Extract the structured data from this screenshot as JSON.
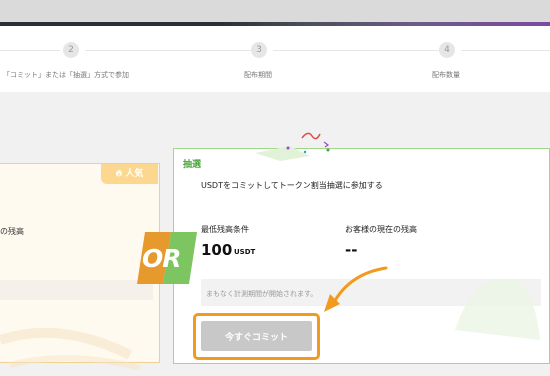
{
  "steps": [
    {
      "num": "",
      "label": "「コミット」または「抽選」方式で参加"
    },
    {
      "num": "2",
      "label": ""
    },
    {
      "num": "3",
      "label": "配布期間"
    },
    {
      "num": "4",
      "label": "配布数量"
    }
  ],
  "left_card": {
    "badge": "人気",
    "text": "の残高"
  },
  "or_label": "OR",
  "lottery_card": {
    "tab_title": "抽選",
    "description": "USDTをコミットしてトークン割当抽選に参加する",
    "min_balance_label": "最低残高条件",
    "min_balance_value": "100",
    "min_balance_unit": "USDT",
    "current_balance_label": "お客様の現在の残高",
    "current_balance_value": "--",
    "notice": "まもなく計測期間が開始されます。",
    "commit_button": "今すぐコミット"
  },
  "colors": {
    "highlight": "#f29a1e",
    "green": "#4aa33b",
    "badge": "#fbd78f"
  }
}
